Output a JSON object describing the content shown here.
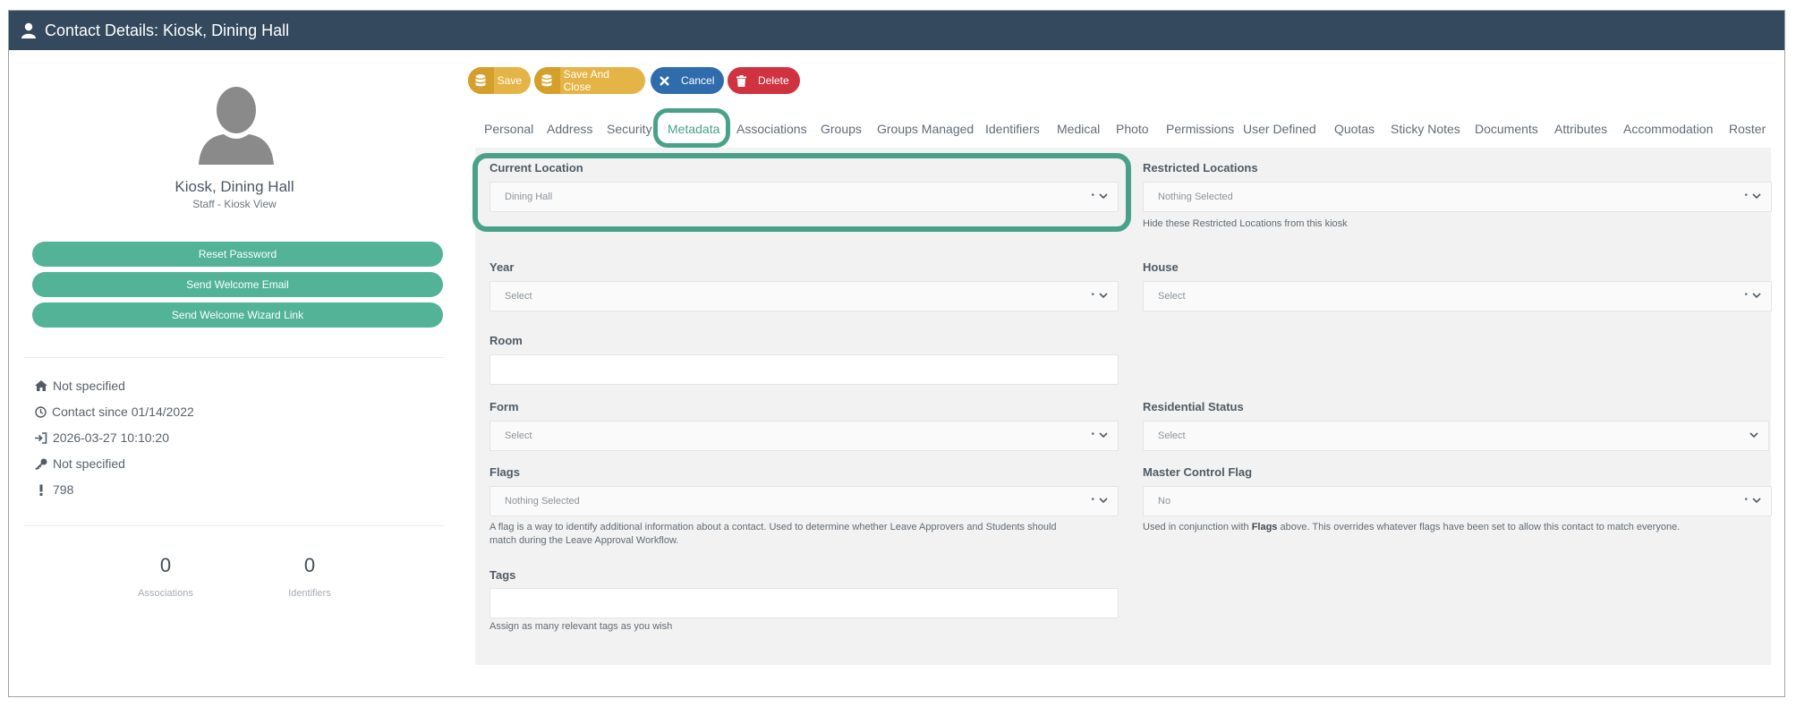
{
  "window": {
    "title": "Contact Details: Kiosk, Dining Hall"
  },
  "profile": {
    "name": "Kiosk, Dining Hall",
    "role": "Staff - Kiosk View",
    "actions": [
      "Reset Password",
      "Send Welcome Email",
      "Send Welcome Wizard Link"
    ],
    "info": [
      {
        "icon": "home-icon",
        "text": "Not specified"
      },
      {
        "icon": "clock-icon",
        "text": "Contact since 01/14/2022"
      },
      {
        "icon": "sign-in-icon",
        "text": "2026-03-27 10:10:20"
      },
      {
        "icon": "key-icon",
        "text": "Not specified"
      },
      {
        "icon": "exclamation-icon",
        "text": "798"
      }
    ],
    "stats": [
      {
        "value": "0",
        "label": "Associations"
      },
      {
        "value": "0",
        "label": "Identifiers"
      }
    ]
  },
  "toolbar": {
    "save": "Save",
    "save_close": "Save And Close",
    "cancel": "Cancel",
    "delete": "Delete"
  },
  "tabs": [
    "Personal",
    "Address",
    "Security",
    "Metadata",
    "Associations",
    "Groups",
    "Groups Managed",
    "Identifiers",
    "Medical",
    "Photo",
    "Permissions",
    "User Defined",
    "Quotas",
    "Sticky Notes",
    "Documents",
    "Attributes",
    "Accommodation",
    "Roster"
  ],
  "active_tab": "Metadata",
  "form": {
    "current_location": {
      "label": "Current Location",
      "value": "Dining Hall"
    },
    "restricted_locations": {
      "label": "Restricted Locations",
      "value": "Nothing Selected",
      "help": "Hide these Restricted Locations from this kiosk"
    },
    "year": {
      "label": "Year",
      "value": "Select"
    },
    "house": {
      "label": "House",
      "value": "Select"
    },
    "room": {
      "label": "Room",
      "value": ""
    },
    "form": {
      "label": "Form",
      "value": "Select"
    },
    "residential_status": {
      "label": "Residential Status",
      "value": "Select"
    },
    "flags": {
      "label": "Flags",
      "value": "Nothing Selected",
      "help1": "A flag is a way to identify additional information about a contact. Used to determine whether Leave Approvers and Students should",
      "help2": "match during the Leave Approval Workflow."
    },
    "master_control_flag": {
      "label": "Master Control Flag",
      "value": "No",
      "help_pre": "Used in conjunction with ",
      "help_bold": "Flags",
      "help_post": " above. This overrides whatever flags have been set to allow this contact to match everyone."
    },
    "tags": {
      "label": "Tags",
      "value": "",
      "help": "Assign as many relevant tags as you wish"
    }
  },
  "colors": {
    "header": "#34495e",
    "accent": "#52b396",
    "highlight": "#4aa18a",
    "save": "#e5b446",
    "cancel": "#2f6cac",
    "delete": "#d0333f"
  }
}
